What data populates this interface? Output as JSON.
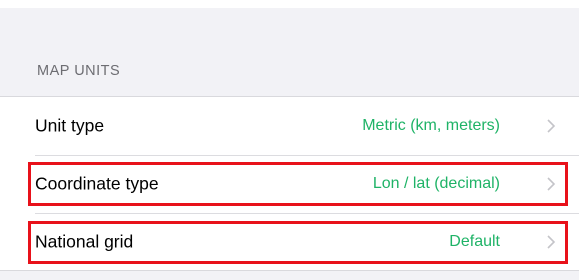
{
  "section": {
    "header": "MAP UNITS"
  },
  "rows": [
    {
      "label": "Unit type",
      "value": "Metric (km, meters)"
    },
    {
      "label": "Coordinate type",
      "value": "Lon / lat (decimal)"
    },
    {
      "label": "National grid",
      "value": "Default"
    }
  ],
  "icons": {
    "row_accessory": "chevron-right-icon"
  },
  "colors": {
    "value_text": "#1fb367",
    "highlight": "#e8111a",
    "background": "#f2f2f6",
    "section_header": "#6d6d72"
  }
}
